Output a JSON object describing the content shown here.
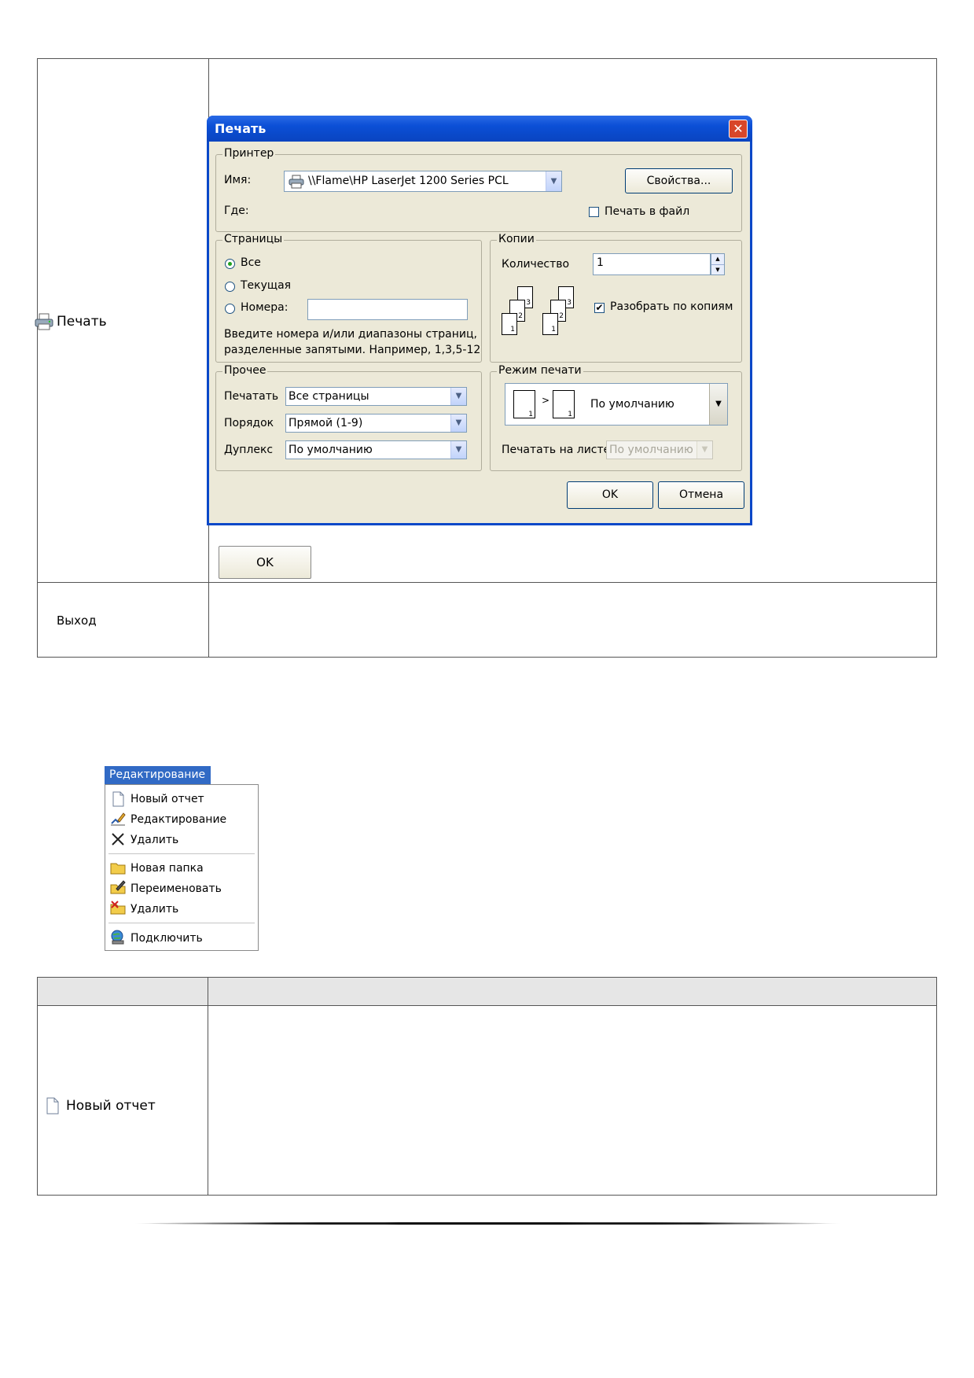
{
  "top_table": {
    "print_row_label": "Печать",
    "exit_row_label": "Выход",
    "ok_button": "OK"
  },
  "print_dialog": {
    "title": "Печать",
    "printer_group": {
      "title": "Принтер",
      "name_label": "Имя:",
      "printer_name": "\\\\Flame\\HP LaserJet 1200 Series PCL",
      "properties_button": "Свойства...",
      "where_label": "Где:",
      "print_to_file_label": "Печать в файл"
    },
    "pages_group": {
      "title": "Страницы",
      "option_all": "Все",
      "option_current": "Текущая",
      "option_numbers": "Номера:",
      "hint_line1": "Введите номера и/или диапазоны страниц,",
      "hint_line2": "разделенные запятыми. Например, 1,3,5-12"
    },
    "copies_group": {
      "title": "Копии",
      "count_label": "Количество",
      "count_value": "1",
      "collate_label": "Разобрать по копиям"
    },
    "other_group": {
      "title": "Прочее",
      "print_label": "Печатать",
      "print_value": "Все страницы",
      "order_label": "Порядок",
      "order_value": "Прямой (1-9)",
      "duplex_label": "Дуплекс",
      "duplex_value": "По умолчанию"
    },
    "mode_group": {
      "title": "Режим печати",
      "mode_value": "По умолчанию",
      "sheet_label": "Печатать на листе",
      "sheet_value": "По умолчанию"
    },
    "ok_button": "OK",
    "cancel_button": "Отмена"
  },
  "edit_menu": {
    "header": "Редактирование",
    "items": [
      {
        "label": "Новый отчет",
        "icon": "new-document-icon"
      },
      {
        "label": "Редактирование",
        "icon": "edit-icon"
      },
      {
        "label": "Удалить",
        "icon": "delete-icon"
      },
      {
        "label": "Новая папка",
        "icon": "new-folder-icon"
      },
      {
        "label": "Переименовать",
        "icon": "rename-folder-icon"
      },
      {
        "label": "Удалить",
        "icon": "delete-folder-icon"
      },
      {
        "label": "Подключить",
        "icon": "connect-icon"
      }
    ]
  },
  "bottom_table": {
    "new_report_label": "Новый отчет"
  }
}
